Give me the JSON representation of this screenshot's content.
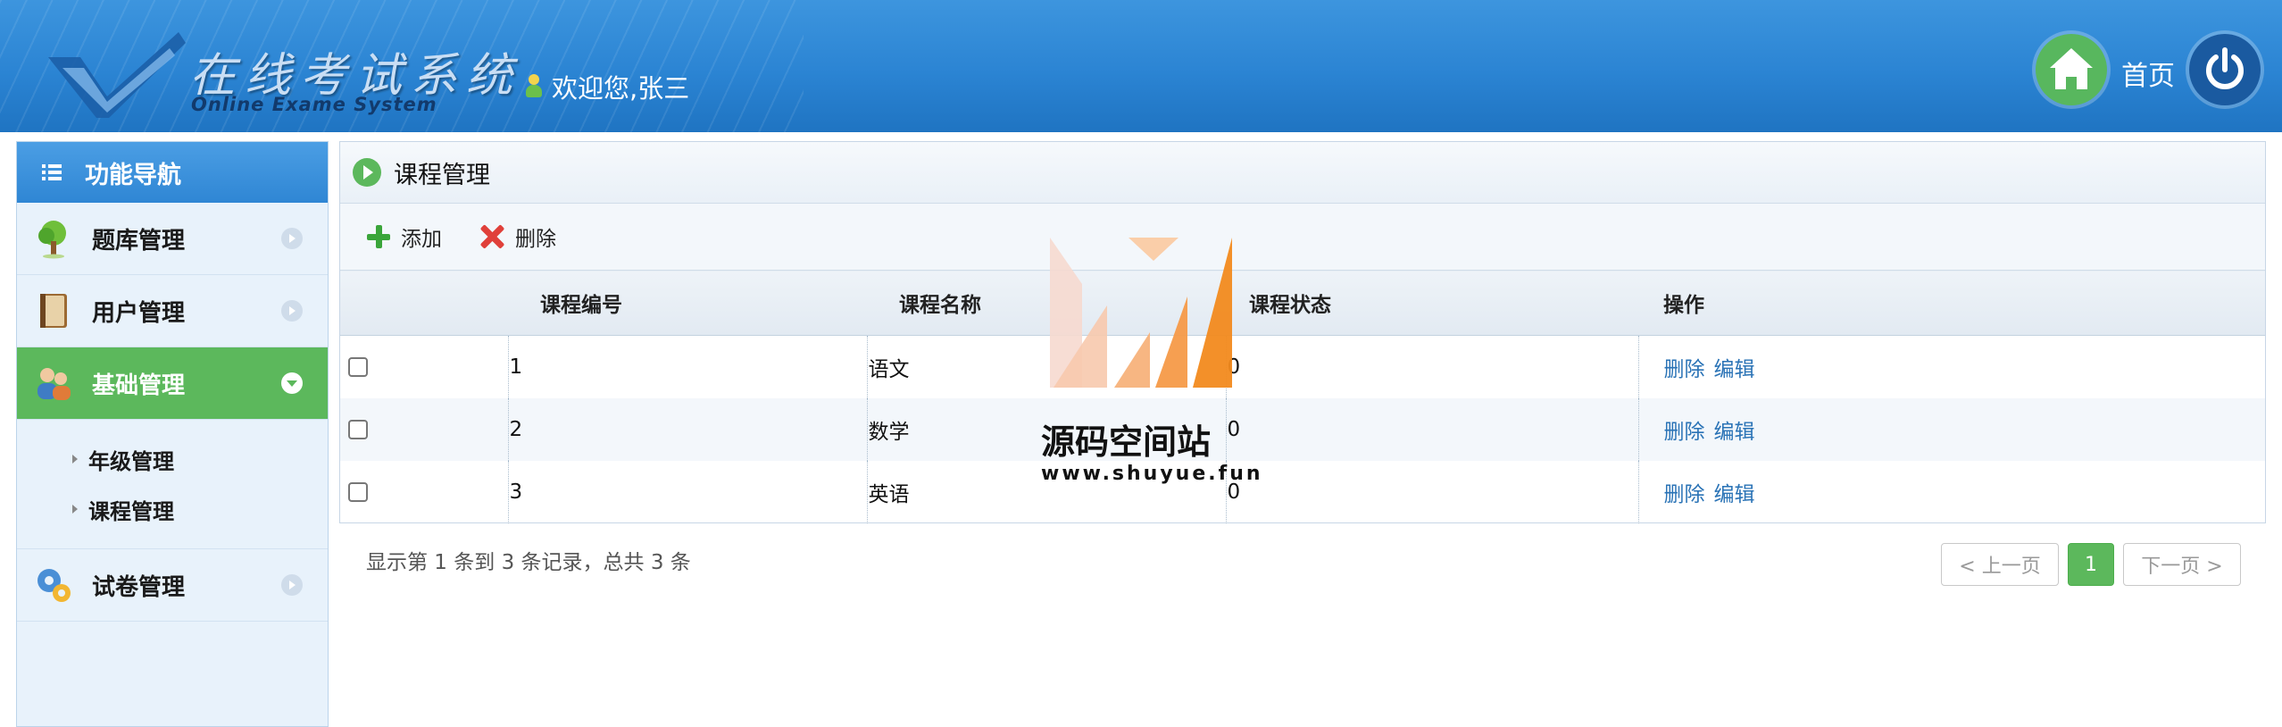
{
  "header": {
    "logo_title": "在线考试系统",
    "logo_subtitle": "Online Exame System",
    "welcome": "欢迎您,张三",
    "home_label": "首页"
  },
  "sidebar": {
    "title": "功能导航",
    "items": [
      {
        "label": "题库管理",
        "icon": "tree-icon"
      },
      {
        "label": "用户管理",
        "icon": "book-icon"
      },
      {
        "label": "基础管理",
        "icon": "users-icon",
        "active": true
      },
      {
        "label": "试卷管理",
        "icon": "gears-icon"
      }
    ],
    "subitems": [
      "年级管理",
      "课程管理"
    ]
  },
  "main": {
    "title": "课程管理",
    "toolbar": {
      "add_label": "添加",
      "delete_label": "删除"
    },
    "table": {
      "headers": [
        "课程编号",
        "课程名称",
        "课程状态",
        "操作"
      ],
      "rows": [
        {
          "id": "1",
          "name": "语文",
          "status": "0"
        },
        {
          "id": "2",
          "name": "数学",
          "status": "0"
        },
        {
          "id": "3",
          "name": "英语",
          "status": "0"
        }
      ],
      "row_actions": {
        "delete": "删除",
        "edit": "编辑"
      }
    },
    "summary": "显示第 1 条到 3 条记录，总共 3 条",
    "pager": {
      "prev": "< 上一页",
      "current": "1",
      "next": "下一页 >"
    }
  },
  "watermark": {
    "text": "源码空间站",
    "url": "www.shuyue.fun"
  },
  "colors": {
    "header_blue": "#2b84d3",
    "active_green": "#5cb85c",
    "link_blue": "#2a73b6"
  }
}
